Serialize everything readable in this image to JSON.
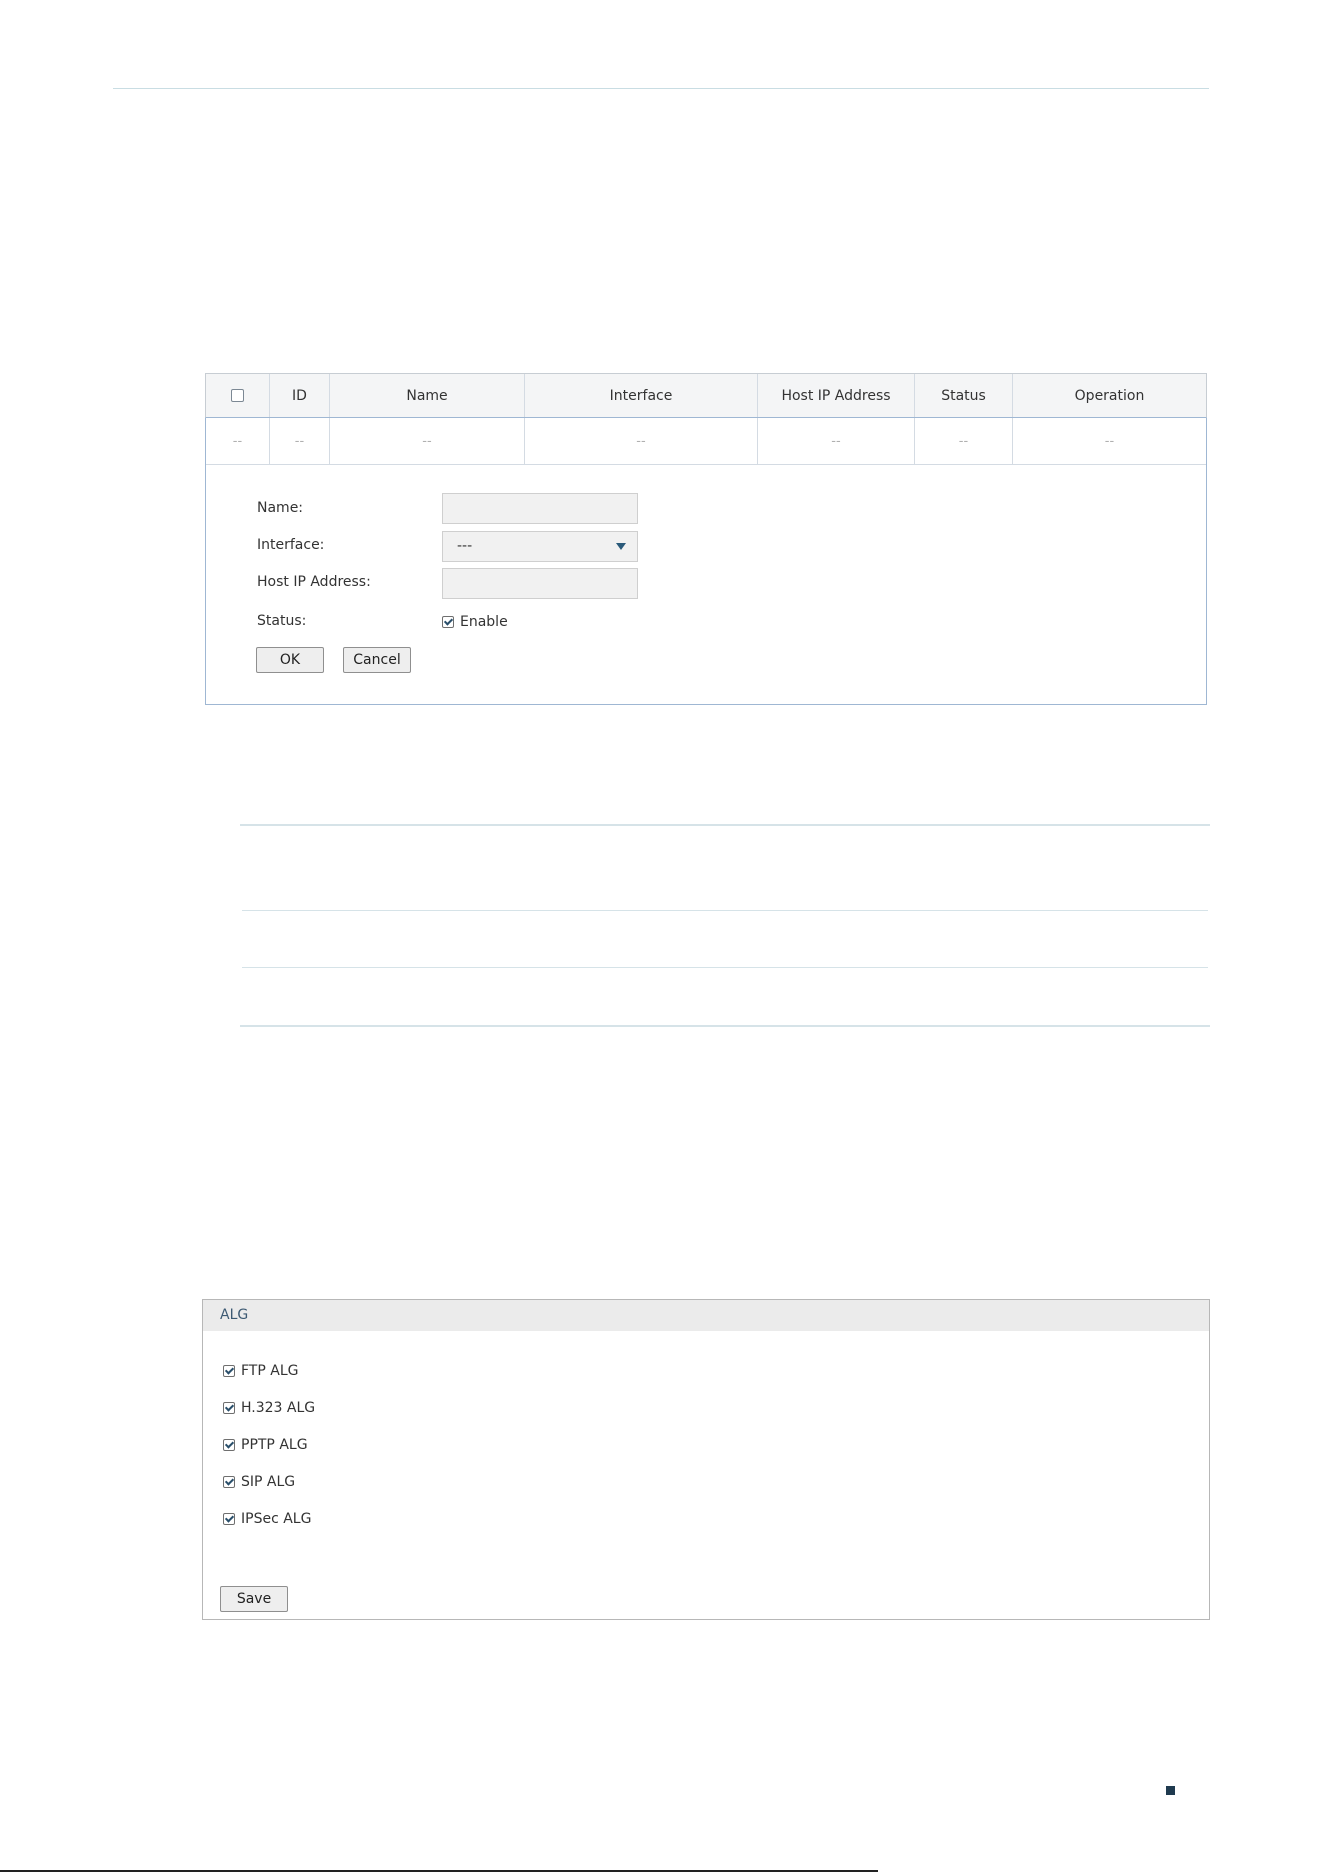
{
  "host_table": {
    "columns": [
      "ID",
      "Name",
      "Interface",
      "Host IP Address",
      "Status",
      "Operation"
    ],
    "empty_row": [
      "--",
      "--",
      "--",
      "--",
      "--",
      "--",
      "--"
    ]
  },
  "host_form": {
    "name_label": "Name:",
    "interface_label": "Interface:",
    "interface_value": "---",
    "host_ip_label": "Host IP Address:",
    "status_label": "Status:",
    "enable_label": "Enable",
    "enable_checked": true,
    "ok_label": "OK",
    "cancel_label": "Cancel"
  },
  "alg": {
    "title": "ALG",
    "items": [
      {
        "label": "FTP ALG",
        "checked": true
      },
      {
        "label": "H.323 ALG",
        "checked": true
      },
      {
        "label": "PPTP ALG",
        "checked": true
      },
      {
        "label": "SIP ALG",
        "checked": true
      },
      {
        "label": "IPSec ALG",
        "checked": true
      }
    ],
    "save_label": "Save"
  },
  "colors": {
    "accent": "#2a5a7a",
    "panel_border": "#9fb7d3",
    "header_bg": "#f4f5f6"
  }
}
